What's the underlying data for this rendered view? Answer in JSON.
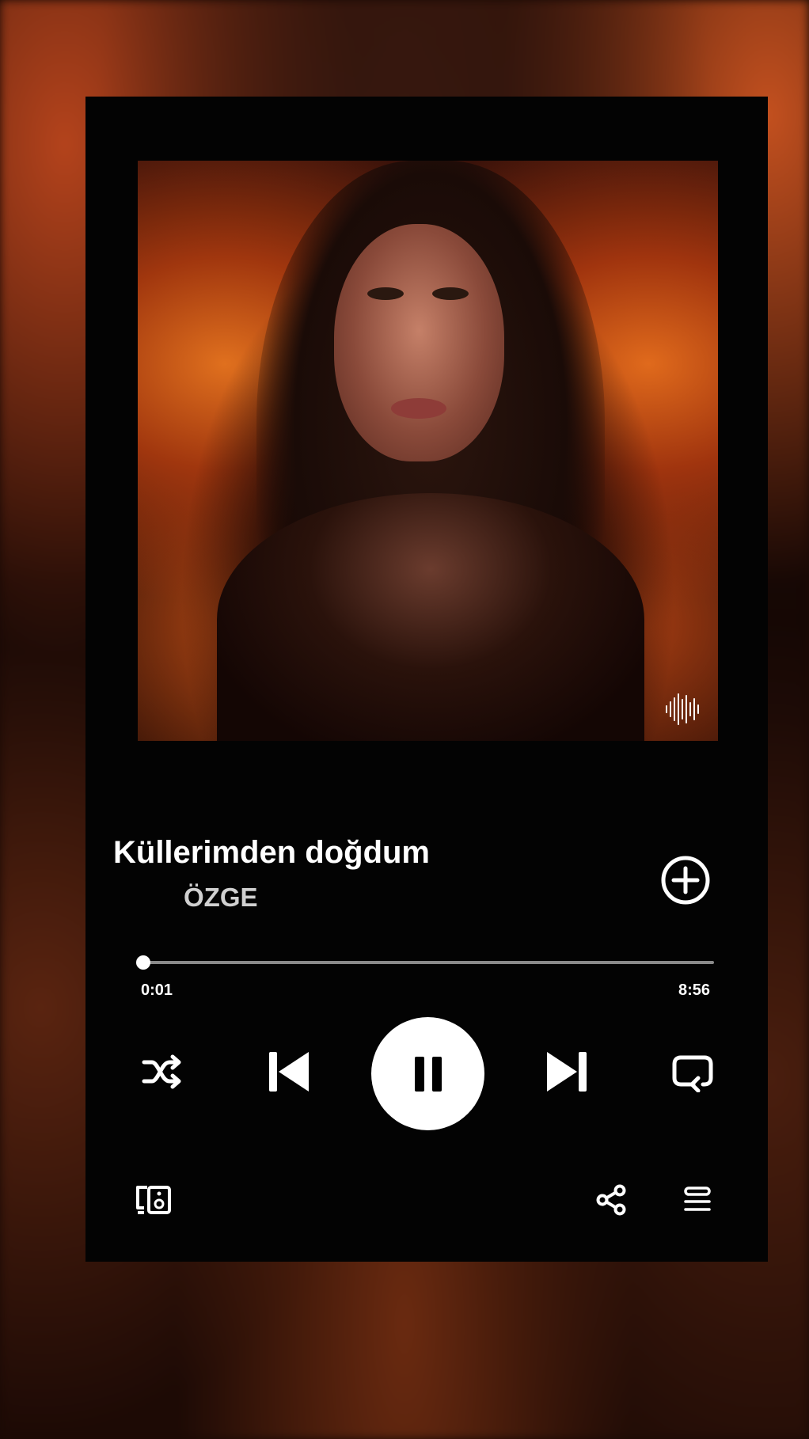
{
  "track": {
    "title": "Küllerimden doğdum",
    "artist": "ÖZGE"
  },
  "playback": {
    "elapsed": "0:01",
    "duration": "8:56",
    "progress_fraction": 0.002,
    "state": "playing"
  },
  "controls": {
    "shuffle_icon": "shuffle-icon",
    "previous_icon": "skip-previous-icon",
    "play_pause_icon": "pause-icon",
    "next_icon": "skip-next-icon",
    "repeat_icon": "repeat-icon",
    "add_icon": "add-circle-icon",
    "devices_icon": "devices-icon",
    "share_icon": "share-icon",
    "queue_icon": "queue-icon"
  },
  "colors": {
    "card_background": "#030303",
    "text_primary": "#ffffff",
    "text_secondary": "#d0d0d0",
    "progress_track": "#8a8a8a"
  }
}
